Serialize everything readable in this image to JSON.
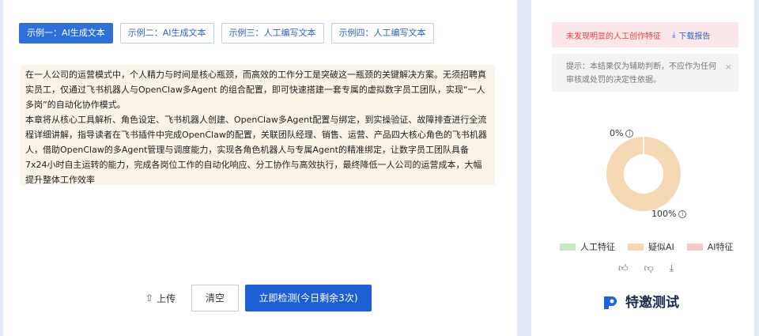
{
  "tabs": [
    {
      "label": "示例一：AI生成文本",
      "active": true
    },
    {
      "label": "示例二：AI生成文本",
      "active": false
    },
    {
      "label": "示例三：人工编写文本",
      "active": false
    },
    {
      "label": "示例四：人工编写文本",
      "active": false
    }
  ],
  "content": {
    "paragraph1": "在一人公司的运营模式中，个人精力与时间是核心瓶颈，而高效的工作分工是突破这一瓶颈的关键解决方案。无须招聘真实员工，仅通过飞书机器人与OpenClaw多Agent 的组合配置，即可快速搭建一套专属的虚拟数字员工团队，实现“一人多岗”的自动化协作模式。",
    "paragraph2": "本章将从核心工具解析、角色设定、飞书机器人创建、OpenClaw多Agent配置与绑定，到实操验证、故障排查进行全流程详细讲解，指导读者在飞书插件中完成OpenClaw的配置，关联团队经理、销售、运营、产品四大核心角色的飞书机器人，借助OpenClaw的多Agent管理与调度能力，实现各角色机器人与专属Agent的精准绑定，让数字员工团队具备7x24小时自主运转的能力，完成各岗位工作的自动化响应、分工协作与高效执行，最终降低一人公司的运营成本，大幅提升整体工作效率"
  },
  "actions": {
    "upload_label": "上传",
    "clear_label": "清空",
    "detect_label": "立即检测(今日剩余3次)"
  },
  "result": {
    "notice": "未发现明显的人工创作特征",
    "download_label": "下载报告",
    "hint": "提示：本结果仅为辅助判断，不应作为任何审核或处罚的决定性依据。",
    "close_glyph": "×"
  },
  "chart_data": {
    "type": "pie",
    "segments": [
      {
        "name": "人工特征",
        "value": 0,
        "color": "#c9e8c4"
      },
      {
        "name": "疑似AI",
        "value": 100,
        "color": "#f5d8b4"
      },
      {
        "name": "AI特征",
        "value": 0,
        "color": "#f6c8cc"
      }
    ],
    "labels": {
      "top": "0%",
      "bottom": "100%"
    }
  },
  "legend": [
    {
      "label": "人工特征",
      "color": "#c9e8c4"
    },
    {
      "label": "疑似AI",
      "color": "#f5d8b4"
    },
    {
      "label": "AI特征",
      "color": "#f6c8cc"
    }
  ],
  "feedback": {
    "like_icon": "thumbs-up-icon",
    "dislike_icon": "thumbs-down-icon",
    "download_icon": "download-icon"
  },
  "brand": {
    "name": "特邀测试"
  }
}
